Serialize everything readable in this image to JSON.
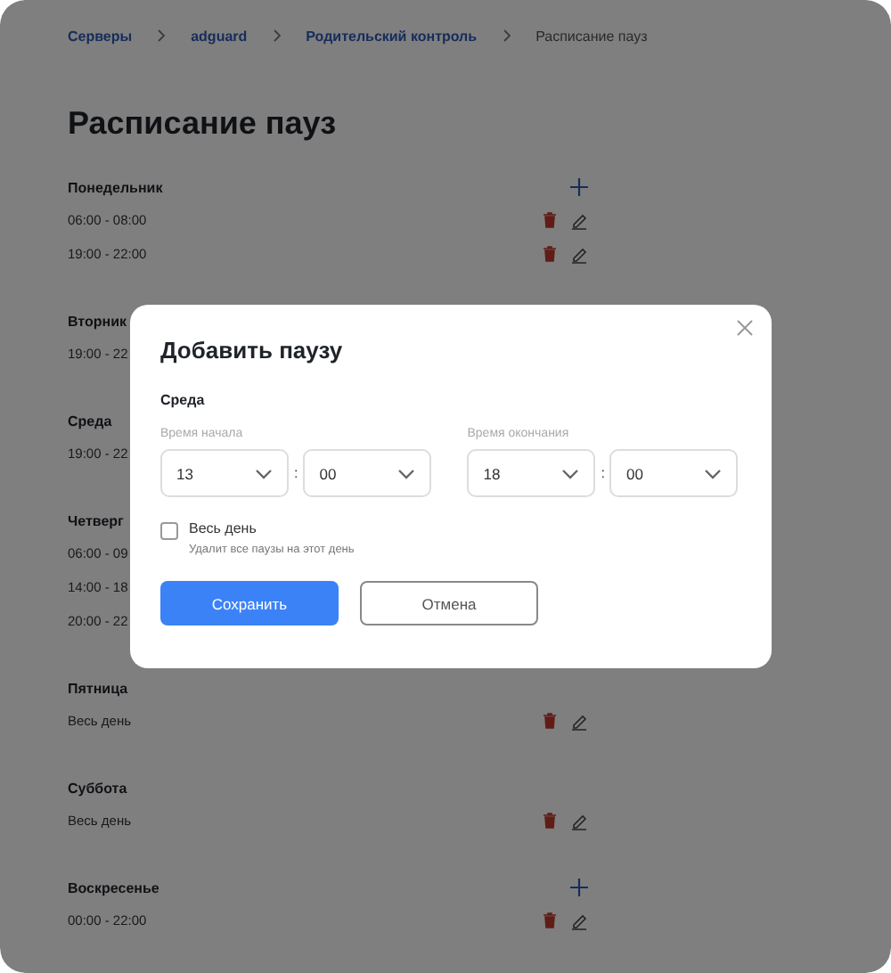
{
  "breadcrumbs": [
    {
      "label": "Серверы",
      "kind": "link"
    },
    {
      "label": "adguard",
      "kind": "link"
    },
    {
      "label": "Родительский контроль",
      "kind": "link"
    },
    {
      "label": "Расписание пауз",
      "kind": "current"
    }
  ],
  "title": "Расписание пауз",
  "days": [
    {
      "name": "Понедельник",
      "addable": true,
      "slots": [
        "06:00 - 08:00",
        "19:00 - 22:00"
      ]
    },
    {
      "name": "Вторник",
      "slots": [
        "19:00 - 22"
      ]
    },
    {
      "name": "Среда",
      "slots": [
        "19:00 - 22"
      ]
    },
    {
      "name": "Четверг",
      "slots": [
        "06:00 - 09",
        "14:00 - 18",
        "20:00 - 22"
      ]
    },
    {
      "name": "Пятница",
      "addable": false,
      "slots": [
        "Весь день"
      ]
    },
    {
      "name": "Суббота",
      "addable": false,
      "slots": [
        "Весь день"
      ]
    },
    {
      "name": "Воскресенье",
      "addable": true,
      "slots": [
        "00:00 - 22:00"
      ]
    }
  ],
  "dialog": {
    "title": "Добавить паузу",
    "day": "Среда",
    "start": {
      "label": "Время начала",
      "hour": "13",
      "minute": "00"
    },
    "end": {
      "label": "Время окончания",
      "hour": "18",
      "minute": "00"
    },
    "separator": ":",
    "all_day": {
      "label": "Весь день",
      "hint": "Удалит все паузы на этот день",
      "checked": false
    },
    "buttons": [
      {
        "label": "Сохранить",
        "kind": "primary"
      },
      {
        "label": "Отмена",
        "kind": "secondary"
      }
    ]
  }
}
